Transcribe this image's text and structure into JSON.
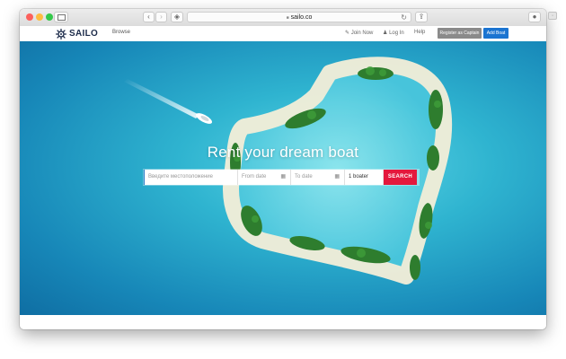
{
  "browser": {
    "url": "sailo.co",
    "lock_icon": "lock-icon",
    "reload_icon": "reload-icon",
    "share_icon": "share-icon"
  },
  "header": {
    "logo_text": "SAILO",
    "logo_icon": "ship-wheel-icon",
    "browse": "Browse",
    "join_now": "Join Now",
    "log_in": "Log In",
    "help": "Help",
    "register_captain": "Register as Captain",
    "add_boat": "Add Boat"
  },
  "hero": {
    "title": "Rent your dream boat"
  },
  "search": {
    "location_placeholder": "Введите местоположение",
    "from_placeholder": "From date",
    "to_placeholder": "To date",
    "guests_value": "1 boater",
    "search_label": "SEARCH"
  },
  "colors": {
    "brand": "#1c2b4a",
    "search_button": "#e4183d",
    "add_boat_button": "#1b74d1",
    "captain_button": "#8a8a8a"
  }
}
